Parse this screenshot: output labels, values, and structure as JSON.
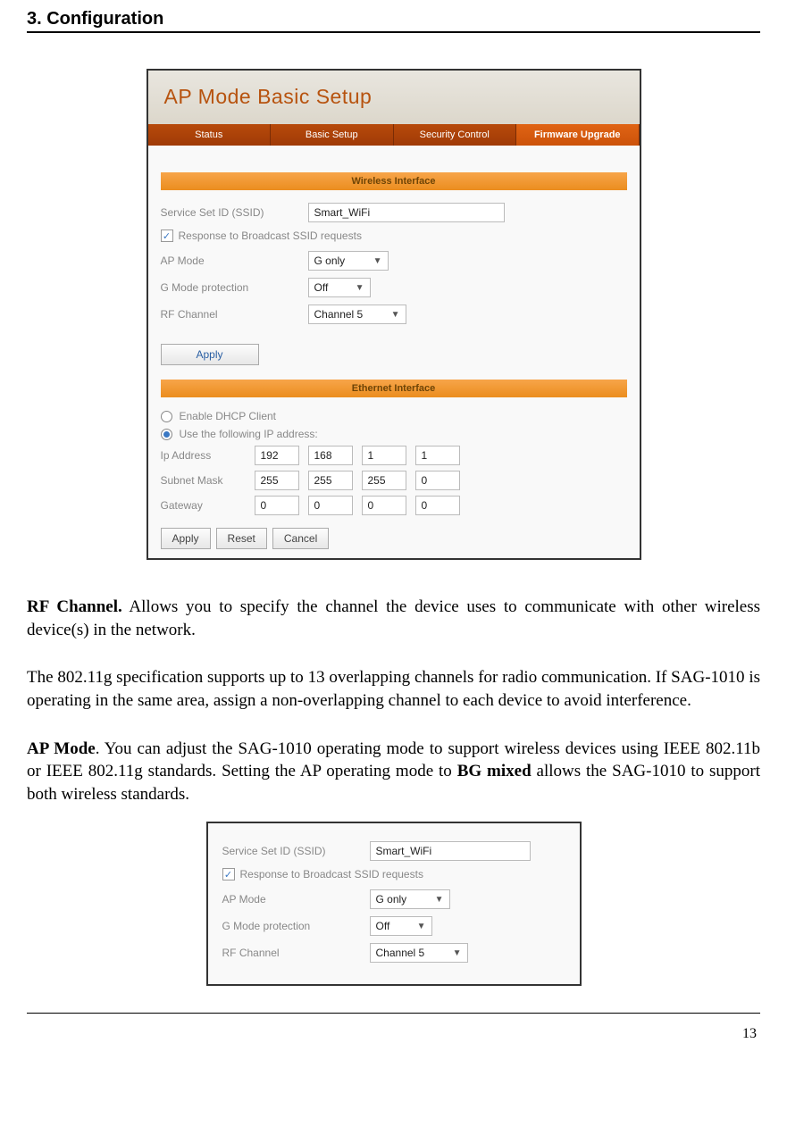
{
  "header": {
    "title": "3. Configuration"
  },
  "fig1": {
    "title": "AP Mode Basic Setup",
    "tabs": {
      "status": "Status",
      "basic": "Basic Setup",
      "security": "Security Control",
      "firmware": "Firmware Upgrade"
    },
    "section1": "Wireless Interface",
    "ssid_label": "Service Set ID (SSID)",
    "ssid_value": "Smart_WiFi",
    "broadcast_label": "Response to Broadcast SSID requests",
    "ap_mode_label": "AP Mode",
    "ap_mode_value": "G only",
    "gmode_label": "G Mode protection",
    "gmode_value": "Off",
    "rf_label": "RF Channel",
    "rf_value": "Channel 5",
    "apply": "Apply",
    "section2": "Ethernet Interface",
    "dhcp_label": "Enable DHCP Client",
    "useip_label": "Use the following IP address:",
    "ip_label": "Ip Address",
    "ip": [
      "192",
      "168",
      "1",
      "1"
    ],
    "mask_label": "Subnet Mask",
    "mask": [
      "255",
      "255",
      "255",
      "0"
    ],
    "gw_label": "Gateway",
    "gw": [
      "0",
      "0",
      "0",
      "0"
    ],
    "reset": "Reset",
    "cancel": "Cancel"
  },
  "para1": {
    "lead": "RF Channel.",
    "rest": " Allows you to specify the channel the device uses to communicate with other wireless device(s) in the network."
  },
  "para2": "The 802.11g specification supports up to 13 overlapping channels for radio communication. If SAG-1010 is operating in the same area, assign a non-overlapping channel to each device to avoid interference.",
  "para3": {
    "lead": "AP Mode",
    "mid": ". You can adjust the SAG-1010 operating mode to support wireless devices using IEEE 802.11b or IEEE 802.11g standards. Setting the AP operating mode to ",
    "bold2": "BG mixed",
    "tail": " allows the SAG-1010 to support both wireless standards."
  },
  "fig2": {
    "ssid_label": "Service Set ID (SSID)",
    "ssid_value": "Smart_WiFi",
    "broadcast_label": "Response to Broadcast SSID requests",
    "ap_mode_label": "AP Mode",
    "ap_mode_value": "G only",
    "gmode_label": "G Mode protection",
    "gmode_value": "Off",
    "rf_label": "RF Channel",
    "rf_value": "Channel 5"
  },
  "page_number": "13"
}
